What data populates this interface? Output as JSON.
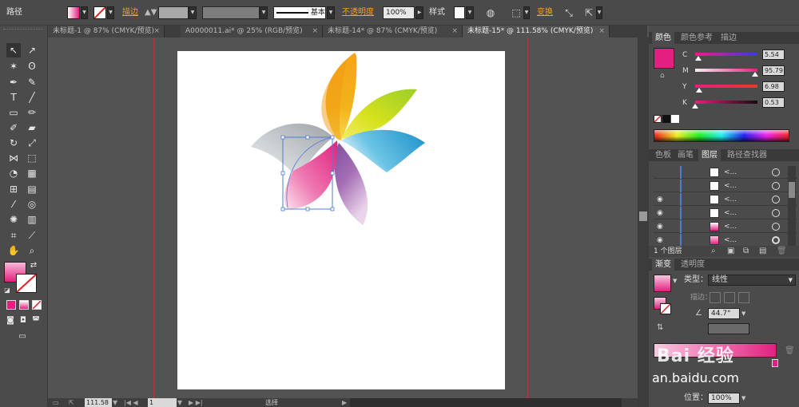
{
  "control_bar": {
    "selection_type": "路径",
    "stroke_label": "描边",
    "stroke_profile": "基本",
    "opacity_label": "不透明度",
    "opacity_value": "100%",
    "style_label": "样式",
    "transform_label": "变换"
  },
  "doc_tabs": [
    {
      "label": "未标题-1 @ 87% (CMYK/预览)",
      "close": "×"
    },
    {
      "label": "A0000011.ai* @ 25% (RGB/预览)",
      "close": "×"
    },
    {
      "label": "未标题-14* @ 87% (CMYK/预览)",
      "close": "×"
    },
    {
      "label": "未标题-15* @ 111.58% (CMYK/预览)",
      "close": "×"
    }
  ],
  "status_bar": {
    "zoom": "111.58",
    "page": "1",
    "tool_name": "选择"
  },
  "color_panel": {
    "tabs": [
      "颜色",
      "颜色参考",
      "描边"
    ],
    "channels": [
      {
        "label": "C",
        "value": "5.54",
        "level": 0.055
      },
      {
        "label": "M",
        "value": "95.79",
        "level": 0.958
      },
      {
        "label": "Y",
        "value": "6.98",
        "level": 0.07
      },
      {
        "label": "K",
        "value": "0.53",
        "level": 0.005
      }
    ],
    "fill_color": "#e3207f"
  },
  "layers_panel": {
    "tabs": [
      "色板",
      "画笔",
      "图层",
      "路径查找器"
    ],
    "rows": [
      {
        "name": "<...",
        "visible": false
      },
      {
        "name": "<...",
        "visible": false
      },
      {
        "name": "<...",
        "visible": true
      },
      {
        "name": "<...",
        "visible": true
      },
      {
        "name": "<...",
        "visible": true
      },
      {
        "name": "<...",
        "visible": true
      }
    ],
    "layer_count": "1 个图层"
  },
  "gradient_panel": {
    "tabs": [
      "渐变",
      "透明度"
    ],
    "type_label": "类型：",
    "type_value": "线性",
    "stroke_label": "描边：",
    "angle_value": "44.7°",
    "location_label": "位置：",
    "location_value": "100%"
  },
  "watermark": {
    "text": "Bai 经验",
    "url": "an.baidu.com"
  }
}
